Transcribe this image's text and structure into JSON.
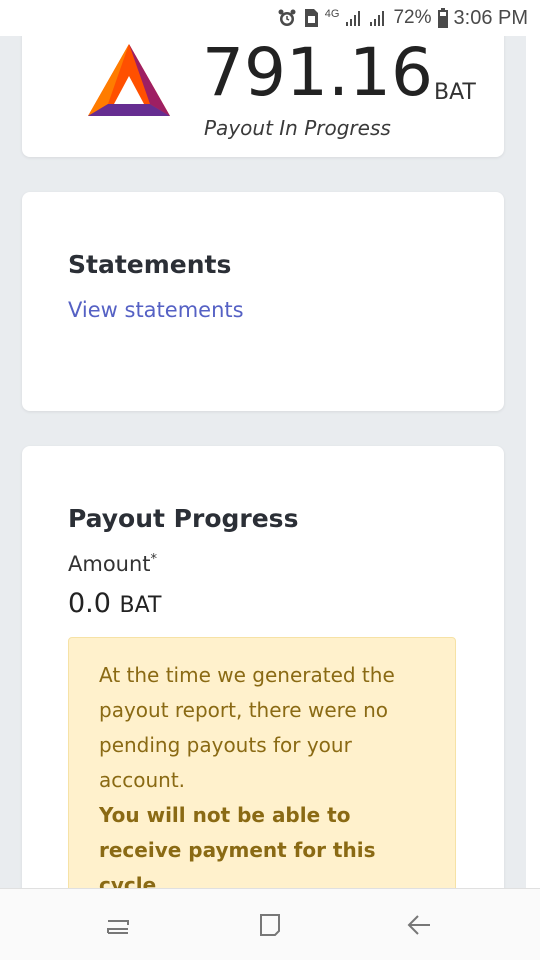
{
  "status_bar": {
    "network": "4G",
    "battery": "72%",
    "time": "3:06 PM",
    "icons": [
      "alarm-icon",
      "sim-icon",
      "signal-icon",
      "signal-icon",
      "battery-icon"
    ]
  },
  "balance": {
    "value": "791.16",
    "unit": "BAT",
    "status": "Payout In Progress",
    "logo": "bat-logo"
  },
  "statements": {
    "title": "Statements",
    "link": "View statements"
  },
  "payout": {
    "title": "Payout Progress",
    "amount_label": "Amount",
    "amount_marker": "*",
    "amount_value": "0.0",
    "amount_unit": "BAT",
    "notice_text": "At the time we generated the payout report, there were no pending payouts for your account.",
    "notice_strong": "You will not be able to receive payment for this cycle."
  },
  "nav": {
    "icons": [
      "recent-apps-icon",
      "home-icon",
      "back-icon"
    ]
  },
  "colors": {
    "accent_link": "#5561c4",
    "notice_bg": "#fff1cc",
    "notice_text": "#8a6a14",
    "page_bg": "#e9ecef"
  }
}
